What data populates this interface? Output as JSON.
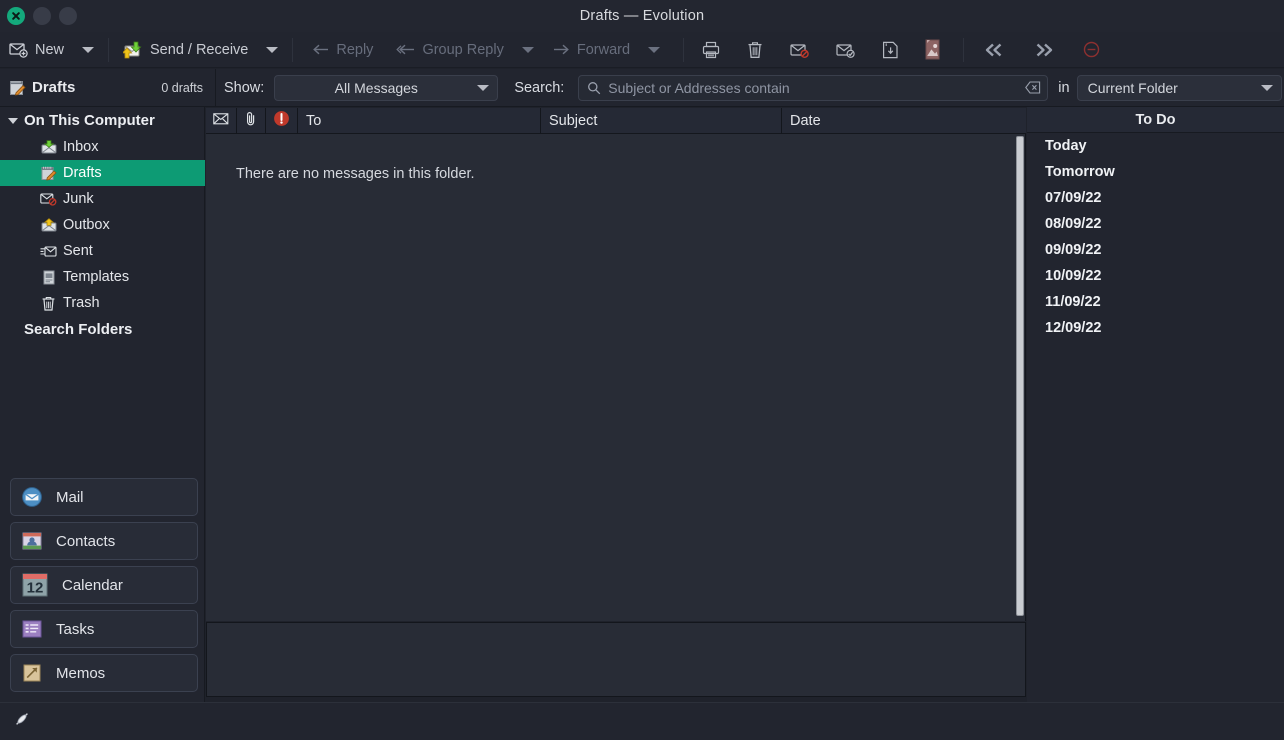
{
  "window": {
    "title": "Drafts — Evolution",
    "buttons": [
      {
        "name": "close",
        "label": ""
      },
      {
        "name": "minimize",
        "label": ""
      },
      {
        "name": "maximize",
        "label": ""
      }
    ]
  },
  "toolbar": {
    "new_label": "New",
    "send_receive_label": "Send / Receive",
    "reply_label": "Reply",
    "group_reply_label": "Group Reply",
    "forward_label": "Forward",
    "icons": [
      "print-icon",
      "delete-icon",
      "mark-unread-icon",
      "mark-read-icon",
      "save-icon",
      "image-icon",
      "previous-unread-icon",
      "next-unread-icon",
      "stop-icon"
    ]
  },
  "searchbar": {
    "folder_name": "Drafts",
    "folder_icon": "drafts-icon",
    "draft_count": "0 drafts",
    "show_label": "Show:",
    "show_value": "All Messages",
    "search_label": "Search:",
    "search_value": "",
    "search_placeholder": "Subject or Addresses contain",
    "in_label": "in",
    "scope_value": "Current Folder"
  },
  "sidebar": {
    "root_label": "On This Computer",
    "folders": [
      {
        "label": "Inbox",
        "icon": "inbox-icon",
        "selected": false
      },
      {
        "label": "Drafts",
        "icon": "drafts-icon",
        "selected": true
      },
      {
        "label": "Junk",
        "icon": "junk-icon",
        "selected": false
      },
      {
        "label": "Outbox",
        "icon": "outbox-icon",
        "selected": false
      },
      {
        "label": "Sent",
        "icon": "sent-icon",
        "selected": false
      },
      {
        "label": "Templates",
        "icon": "templates-icon",
        "selected": false
      },
      {
        "label": "Trash",
        "icon": "trash-icon",
        "selected": false
      }
    ],
    "search_folders_label": "Search Folders",
    "switcher": [
      {
        "label": "Mail",
        "icon": "mail-icon"
      },
      {
        "label": "Contacts",
        "icon": "contacts-icon"
      },
      {
        "label": "Calendar",
        "icon": "calendar-icon"
      },
      {
        "label": "Tasks",
        "icon": "tasks-icon"
      },
      {
        "label": "Memos",
        "icon": "memos-icon"
      }
    ]
  },
  "messagelist": {
    "columns": [
      {
        "label": "",
        "icon": "envelope-icon"
      },
      {
        "label": "",
        "icon": "attachment-icon"
      },
      {
        "label": "",
        "icon": "importance-icon"
      },
      {
        "label": "To"
      },
      {
        "label": "Subject"
      },
      {
        "label": "Date"
      }
    ],
    "empty_text": "There are no messages in this folder.",
    "rows": []
  },
  "todo": {
    "title": "To Do",
    "items": [
      {
        "label": "Today"
      },
      {
        "label": "Tomorrow"
      },
      {
        "label": "07/09/22"
      },
      {
        "label": "08/09/22"
      },
      {
        "label": "09/09/22"
      },
      {
        "label": "10/09/22"
      },
      {
        "label": "11/09/22"
      },
      {
        "label": "12/09/22"
      }
    ]
  },
  "statusbar": {
    "icon": "activity-icon",
    "text": ""
  },
  "colors": {
    "accent": "#0d9b74",
    "window_bg": "#22252f",
    "list_bg": "#282c36",
    "text": "#e4e6ea",
    "muted_text": "#6b7180",
    "close_button": "#14a97c",
    "importance": "#c0392b"
  }
}
